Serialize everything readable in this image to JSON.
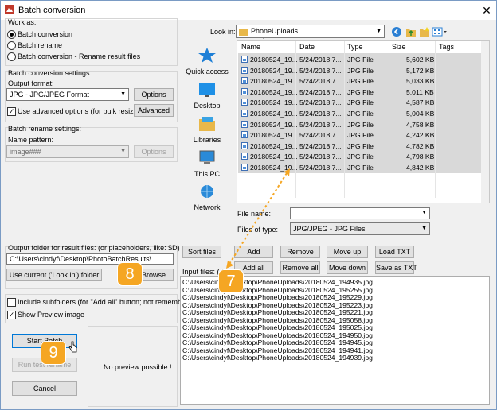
{
  "window": {
    "title": "Batch conversion",
    "close_glyph": "✕"
  },
  "work_as": {
    "label": "Work as:",
    "options": [
      "Batch conversion",
      "Batch rename",
      "Batch conversion - Rename result files"
    ],
    "selected": 0
  },
  "conversion": {
    "label": "Batch conversion settings:",
    "format_label": "Output format:",
    "format_value": "JPG - JPG/JPEG Format",
    "options_btn": "Options",
    "advanced_chk": "Use advanced options (for bulk resize....)",
    "advanced_checked": true,
    "advanced_btn": "Advanced"
  },
  "rename": {
    "label": "Batch rename settings:",
    "pattern_label": "Name pattern:",
    "pattern_value": "image###",
    "options_btn": "Options"
  },
  "output": {
    "label": "Output folder for result files: (or placeholders, like: $D)",
    "value": "C:\\Users\\cindyf\\Desktop\\PhotoBatchResults\\",
    "use_current_btn": "Use current ('Look in') folder",
    "browse_btn": "Browse"
  },
  "options": {
    "subfolders": "Include subfolders (for \"Add all\" button; not remembered)",
    "subfolders_checked": false,
    "preview": "Show Preview image",
    "preview_checked": true
  },
  "actions": {
    "start": "Start Batch",
    "test": "Run test rename",
    "cancel": "Cancel"
  },
  "preview": {
    "text": "No preview possible !"
  },
  "lookin": {
    "label": "Look in:",
    "value": "PhoneUploads"
  },
  "places": [
    "Quick access",
    "Desktop",
    "Libraries",
    "This PC",
    "Network"
  ],
  "columns": [
    "Name",
    "Date",
    "Type",
    "Size",
    "Tags"
  ],
  "files": [
    {
      "name": "20180524_19...",
      "date": "5/24/2018 7...",
      "type": "JPG File",
      "size": "5,602 KB"
    },
    {
      "name": "20180524_19...",
      "date": "5/24/2018 7...",
      "type": "JPG File",
      "size": "5,172 KB"
    },
    {
      "name": "20180524_19...",
      "date": "5/24/2018 7...",
      "type": "JPG File",
      "size": "5,033 KB"
    },
    {
      "name": "20180524_19...",
      "date": "5/24/2018 7...",
      "type": "JPG File",
      "size": "5,011 KB"
    },
    {
      "name": "20180524_19...",
      "date": "5/24/2018 7...",
      "type": "JPG File",
      "size": "4,587 KB"
    },
    {
      "name": "20180524_19...",
      "date": "5/24/2018 7...",
      "type": "JPG File",
      "size": "5,004 KB"
    },
    {
      "name": "20180524_19...",
      "date": "5/24/2018 7...",
      "type": "JPG File",
      "size": "4,758 KB"
    },
    {
      "name": "20180524_19...",
      "date": "5/24/2018 7...",
      "type": "JPG File",
      "size": "4,242 KB"
    },
    {
      "name": "20180524_19...",
      "date": "5/24/2018 7...",
      "type": "JPG File",
      "size": "4,782 KB"
    },
    {
      "name": "20180524_19...",
      "date": "5/24/2018 7...",
      "type": "JPG File",
      "size": "4,798 KB"
    },
    {
      "name": "20180524_19...",
      "date": "5/24/2018 7...",
      "type": "JPG File",
      "size": "4,842 KB"
    }
  ],
  "filename": {
    "label": "File name:",
    "value": ""
  },
  "filetype": {
    "label": "Files of type:",
    "value": "JPG/JPEG - JPG Files"
  },
  "list_buttons": [
    "Sort files",
    "Add",
    "Remove",
    "Move up",
    "Load TXT",
    "Add all",
    "Remove all",
    "Move down",
    "Save as TXT"
  ],
  "input_files_label": "Input files: ( 11",
  "input_files": [
    "C:\\Users\\cindyf\\Desktop\\PhoneUploads\\20180524_194935.jpg",
    "C:\\Users\\cindyf\\Desktop\\PhoneUploads\\20180524_195255.jpg",
    "C:\\Users\\cindyf\\Desktop\\PhoneUploads\\20180524_195229.jpg",
    "C:\\Users\\cindyf\\Desktop\\PhoneUploads\\20180524_195223.jpg",
    "C:\\Users\\cindyf\\Desktop\\PhoneUploads\\20180524_195221.jpg",
    "C:\\Users\\cindyf\\Desktop\\PhoneUploads\\20180524_195058.jpg",
    "C:\\Users\\cindyf\\Desktop\\PhoneUploads\\20180524_195025.jpg",
    "C:\\Users\\cindyf\\Desktop\\PhoneUploads\\20180524_194950.jpg",
    "C:\\Users\\cindyf\\Desktop\\PhoneUploads\\20180524_194945.jpg",
    "C:\\Users\\cindyf\\Desktop\\PhoneUploads\\20180524_194941.jpg",
    "C:\\Users\\cindyf\\Desktop\\PhoneUploads\\20180524_194939.jpg"
  ],
  "callouts": [
    "7",
    "8",
    "9"
  ],
  "colors": {
    "badge": "#f5a623",
    "selection": "#d9d9d9",
    "accent": "#0078d7"
  }
}
